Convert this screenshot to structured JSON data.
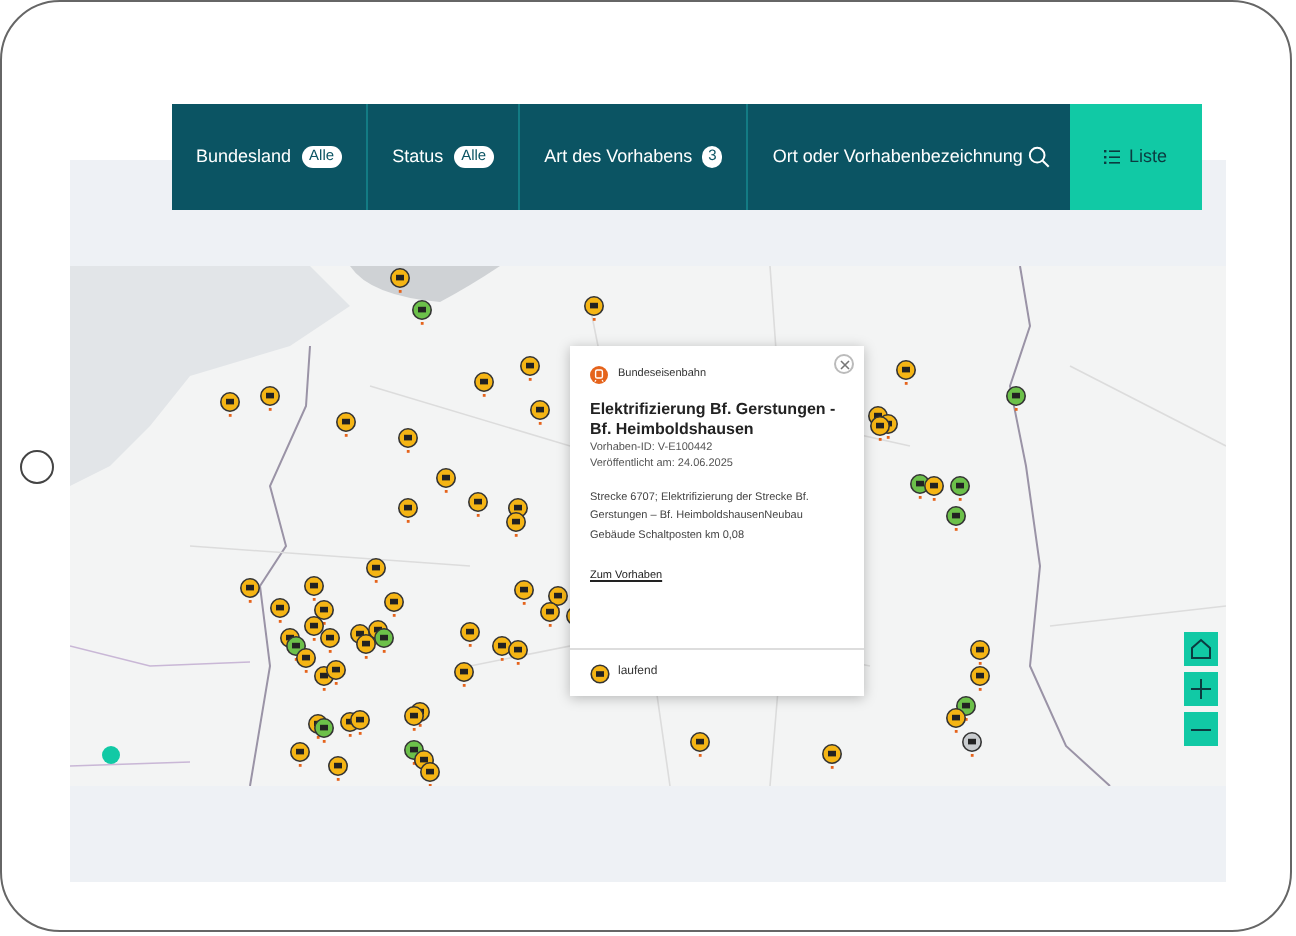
{
  "filters": [
    {
      "label": "Bundesland",
      "badge": "Alle"
    },
    {
      "label": "Status",
      "badge": "Alle"
    },
    {
      "label": "Art des Vorhabens",
      "badge": "3"
    }
  ],
  "search": {
    "placeholder": "Ort oder Vorhabenbezeichnung"
  },
  "list_button": {
    "label": "Liste"
  },
  "popup": {
    "operator": "Bundeseisenbahn",
    "title": "Elektrifizierung Bf. Gerstungen - Bf. Heimboldshausen",
    "id_line": "Vorhaben-ID: V-E100442",
    "published": "Veröffentlicht am: 24.06.2025",
    "description": "Strecke 6707; Elektrifizierung der Strecke Bf. Gerstungen – Bf. HeimboldshausenNeubau Gebäude Schaltposten km 0,08",
    "link": "Zum Vorhaben",
    "status": "laufend"
  }
}
